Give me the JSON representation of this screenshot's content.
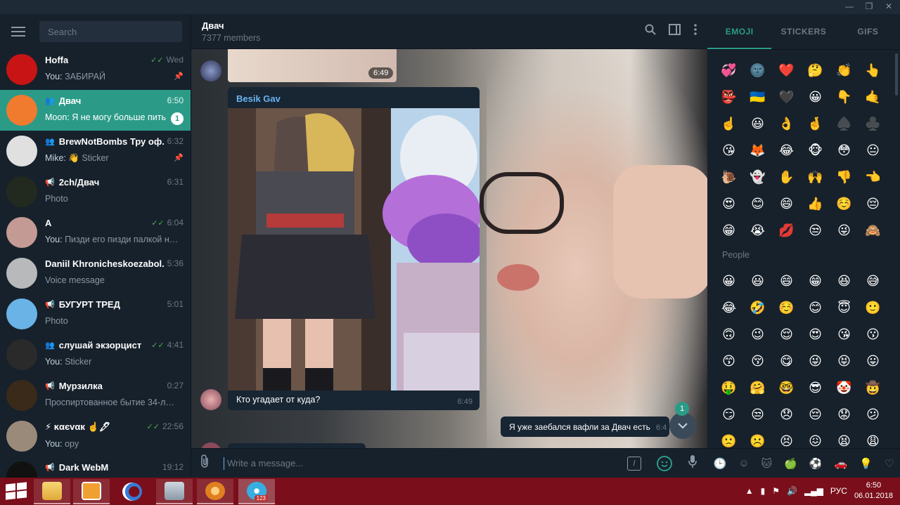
{
  "window": {
    "minimize": "—",
    "restore": "❐",
    "close": "✕"
  },
  "sidebar": {
    "search_placeholder": "Search",
    "chats": [
      {
        "name": "Hoffa",
        "time": "Wed",
        "sender": "You:",
        "preview": "ЗАБИРАЙ",
        "read": true,
        "pinned": true,
        "type": "user",
        "avatar_color": "#c81414"
      },
      {
        "name": "Двач",
        "time": "6:50",
        "sender": "Moon:",
        "preview": "Я не могу больше пить",
        "unread": "1",
        "type": "group",
        "active": true,
        "avatar_color": "#f07a2e"
      },
      {
        "name": "BrewNotBombs Тру оф...",
        "time": "6:32",
        "sender": "Mike:",
        "preview": "👋 Sticker",
        "pinned": true,
        "type": "group",
        "avatar_color": "#e0e0e0"
      },
      {
        "name": "2ch/Двач",
        "time": "6:31",
        "sender": "",
        "preview": "Photo",
        "type": "channel",
        "avatar_color": "#222a20"
      },
      {
        "name": "A",
        "time": "6:04",
        "sender": "You:",
        "preview": "Пизди его пизди палкой на...",
        "read": true,
        "type": "user",
        "avatar_color": "#c49a94"
      },
      {
        "name": "Daniil Khronicheskoezabol...",
        "time": "5:36",
        "sender": "",
        "preview": "Voice message",
        "type": "user",
        "avatar_color": "#b7b9bb"
      },
      {
        "name": "БУГУРТ ТРЕД",
        "time": "5:01",
        "sender": "",
        "preview": "Photo",
        "type": "channel",
        "avatar_color": "#6ab3e6"
      },
      {
        "name": "слушай экзорцист",
        "time": "4:41",
        "sender": "You:",
        "preview": "Sticker",
        "read": true,
        "type": "group",
        "avatar_color": "#2a2a2a"
      },
      {
        "name": "Мурзилка",
        "time": "0:27",
        "sender": "",
        "preview": "Проспиртованное бытие 34-лет...",
        "type": "channel",
        "avatar_color": "#3a2a1a"
      },
      {
        "name": "⚡ ĸαєvαк ☝️🖋",
        "time": "22:56",
        "sender": "You:",
        "preview": "ору",
        "read": true,
        "type": "user",
        "avatar_color": "#9a8a7a"
      },
      {
        "name": "Dark WebM",
        "time": "19:12",
        "sender": "",
        "preview": "",
        "type": "channel",
        "avatar_color": "#111111"
      }
    ]
  },
  "chat": {
    "title": "Двач",
    "members": "7377 members",
    "top_photo_time": "6:49",
    "message_author": "Besik Gav",
    "message_text": "Кто угадает от куда?",
    "message_time": "6:49",
    "outgoing_text": "Я уже заебался вафли за Двач есть",
    "outgoing_time": "6:4",
    "unread_count": "1",
    "composer_placeholder": "Write a message...",
    "cmd_label": "/"
  },
  "emoji_panel": {
    "tabs": [
      "EMOJI",
      "STICKERS",
      "GIFS"
    ],
    "active_tab": "EMOJI",
    "recent": [
      "💞",
      "🌚",
      "❤️",
      "🤔",
      "👏",
      "👆",
      "👺",
      "🇺🇦",
      "🖤",
      "😀",
      "👇",
      "🤙",
      "☝️",
      "😃",
      "👌",
      "🤞",
      "♠️",
      "♣️",
      "😘",
      "🦊",
      "😂",
      "🐵",
      "😳",
      "😐",
      "🐌",
      "👻",
      "✋",
      "🙌",
      "👎",
      "👈",
      "😍",
      "😊",
      "😄",
      "👍",
      "☺️",
      "😔",
      "😁",
      "😭",
      "💋",
      "😒",
      "😜",
      "🙈"
    ],
    "section_title": "People",
    "people": [
      "😀",
      "😃",
      "😄",
      "😁",
      "😆",
      "😅",
      "😂",
      "🤣",
      "☺️",
      "😊",
      "😇",
      "🙂",
      "🙃",
      "😉",
      "😌",
      "😍",
      "😘",
      "😗",
      "😙",
      "😚",
      "😋",
      "😜",
      "😝",
      "😛",
      "🤑",
      "🤗",
      "🤓",
      "😎",
      "🤡",
      "🤠",
      "😏",
      "😒",
      "😞",
      "😔",
      "😟",
      "😕",
      "🙁",
      "☹️",
      "😣",
      "😖",
      "😫",
      "😩"
    ],
    "categories": [
      "🕒",
      "☺",
      "🐱",
      "🍏",
      "⚽",
      "🚗",
      "💡",
      "♡"
    ]
  },
  "taskbar": {
    "apps": [
      "folder-icon",
      "media-player-icon",
      "browser-icon",
      "photos-icon",
      "helm-icon",
      "telegram-icon"
    ],
    "telegram_badge": "123",
    "lang": "РУС",
    "time": "6:50",
    "date": "06.01.2018"
  },
  "colors": {
    "accent": "#2b9b88",
    "link": "#6ab3f3",
    "taskbar": "#7a0f1b",
    "bg": "#17212b"
  }
}
